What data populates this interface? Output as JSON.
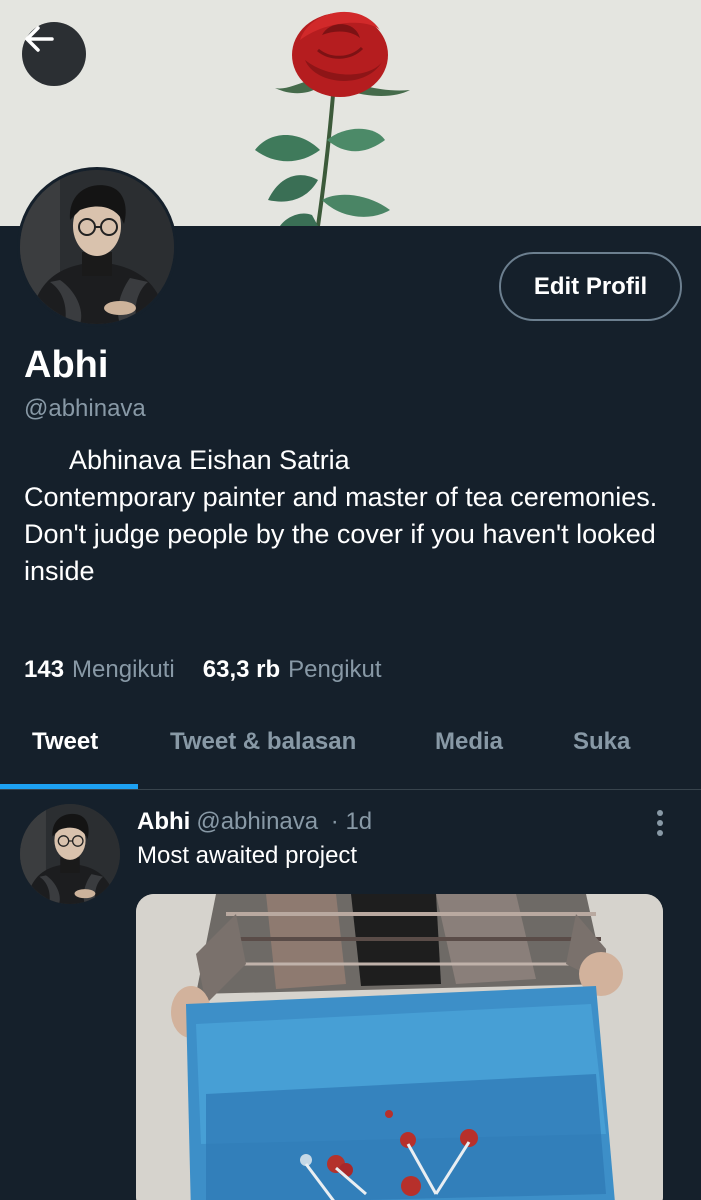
{
  "profile": {
    "name": "Abhi",
    "handle": "@abhinava",
    "edit_label": "Edit Profil",
    "bio": "      Abhinava Eishan Satria\nContemporary painter and master of tea ceremonies.\nDon't judge people by the cover if you haven't looked inside",
    "following_count": "143",
    "following_label": "Mengikuti",
    "followers_count": "63,3 rb",
    "followers_label": "Pengikut"
  },
  "tabs": [
    {
      "label": "Tweet",
      "active": true
    },
    {
      "label": "Tweet & balasan",
      "active": false
    },
    {
      "label": "Media",
      "active": false
    },
    {
      "label": "Suka",
      "active": false
    }
  ],
  "tweet": {
    "name": "Abhi",
    "handle": "@abhinava",
    "time": "· 1d",
    "text": "Most awaited project"
  },
  "icons": {
    "back": "arrow-left-icon",
    "more": "more-vertical-icon"
  },
  "colors": {
    "background": "#15202b",
    "accent": "#1da1f2",
    "secondary_text": "#8899a6",
    "banner_bg": "#e4e5e0"
  }
}
